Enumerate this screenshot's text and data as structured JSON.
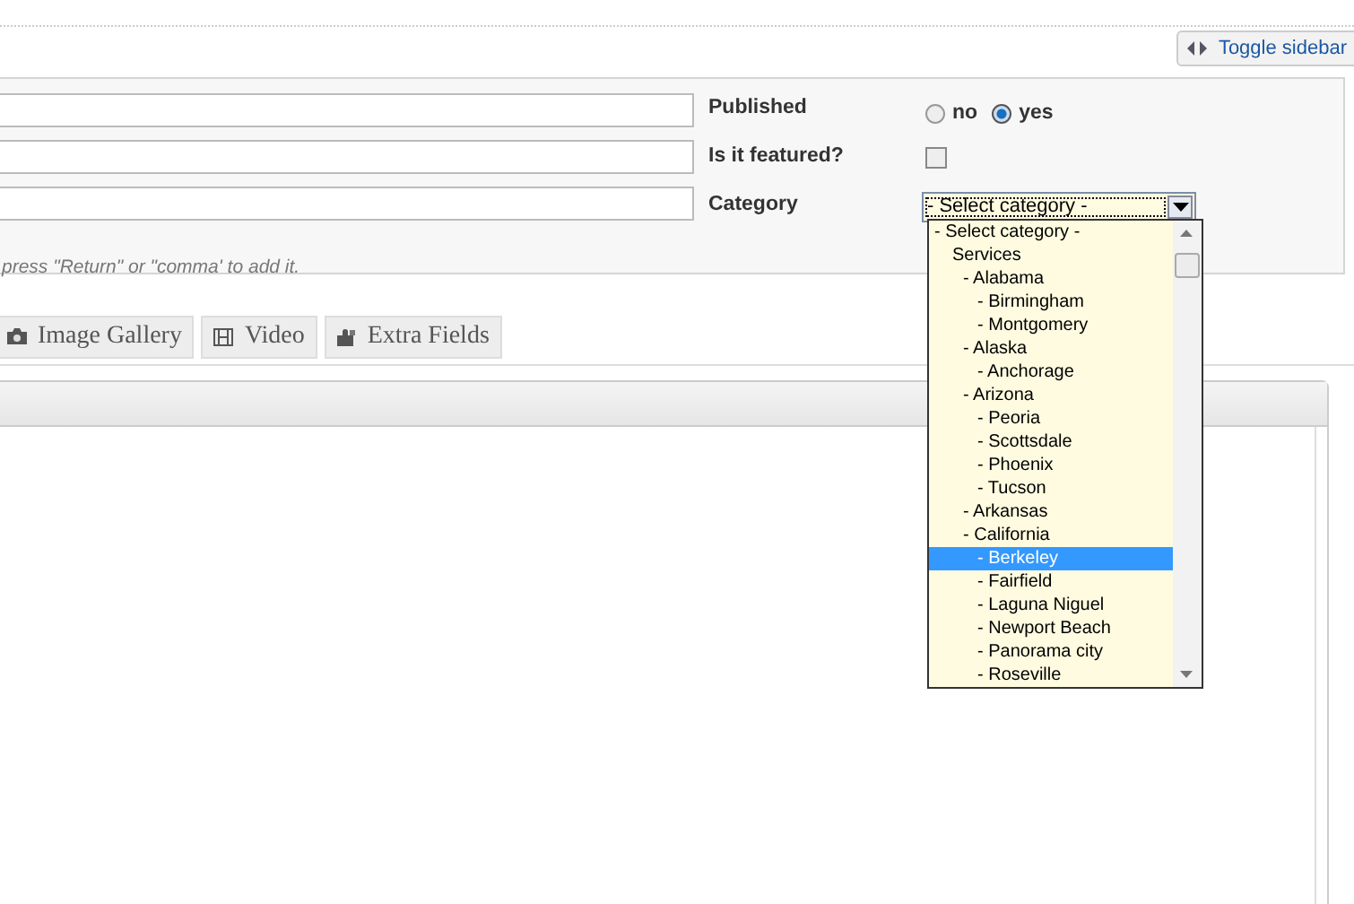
{
  "toolbar": {
    "toggle_button": "Toggle sidebar"
  },
  "form": {
    "fields": [
      {
        "kind": "text"
      },
      {
        "kind": "text"
      },
      {
        "kind": "text"
      }
    ],
    "published": {
      "label": "Published",
      "options": [
        {
          "label": "no",
          "selected": false
        },
        {
          "label": "yes",
          "selected": true
        }
      ]
    },
    "featured": {
      "label": "Is it featured?",
      "checked": false
    },
    "category": {
      "label": "Category",
      "value": "- Select category -",
      "expanded": true
    },
    "hint": "press \"Return\" or \"comma' to add it."
  },
  "tabs": [
    {
      "label": "Image Gallery"
    },
    {
      "label": "Video"
    },
    {
      "label": "Extra Fields"
    }
  ],
  "category_list": [
    {
      "label": "- Select category -",
      "selected": false
    },
    {
      "label": "Services",
      "selected": false,
      "children": [
        {
          "label": "- Alabama",
          "selected": false,
          "children": [
            {
              "label": "- Birmingham",
              "selected": false
            },
            {
              "label": "- Montgomery",
              "selected": false
            }
          ]
        },
        {
          "label": "- Alaska",
          "selected": false,
          "children": [
            {
              "label": "- Anchorage",
              "selected": false
            }
          ]
        },
        {
          "label": "- Arizona",
          "selected": false,
          "children": [
            {
              "label": "- Peoria",
              "selected": false
            },
            {
              "label": "- Scottsdale",
              "selected": false
            },
            {
              "label": "- Phoenix",
              "selected": false
            },
            {
              "label": "- Tucson",
              "selected": false
            }
          ]
        },
        {
          "label": "- Arkansas",
          "selected": false
        },
        {
          "label": "- California",
          "selected": false,
          "children": [
            {
              "label": "- Berkeley",
              "selected": true
            },
            {
              "label": "- Fairfield",
              "selected": false
            },
            {
              "label": "- Laguna Niguel",
              "selected": false
            },
            {
              "label": "- Newport Beach",
              "selected": false
            },
            {
              "label": "- Panorama city",
              "selected": false
            },
            {
              "label": "- Roseville",
              "selected": false
            }
          ]
        }
      ]
    }
  ]
}
